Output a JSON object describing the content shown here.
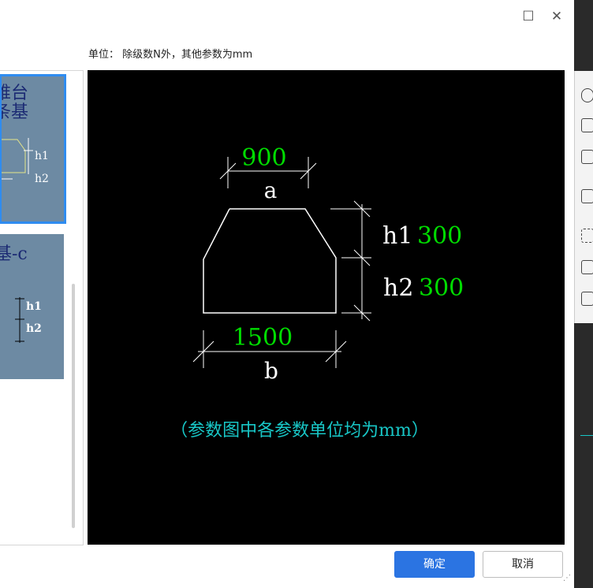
{
  "window": {
    "maximize_glyph": "☐",
    "close_glyph": "✕"
  },
  "unit_note": "单位： 除级数N外，其他参数为mm",
  "thumbnails": [
    {
      "title_line1": "锥台",
      "title_line2": "条基",
      "label1": "h1",
      "label2": "h2",
      "selected": true
    },
    {
      "title_line1": "基-c",
      "label1": "h1",
      "label2": "h2",
      "selected": false
    }
  ],
  "diagram": {
    "top_width_value": "900",
    "top_width_name": "a",
    "h1_name": "h1",
    "h1_value": "300",
    "h2_name": "h2",
    "h2_value": "300",
    "bottom_width_value": "1500",
    "bottom_width_name": "b",
    "note": "（参数图中各参数单位均为mm）"
  },
  "buttons": {
    "ok": "确定",
    "cancel": "取消"
  },
  "colors": {
    "green": "#00dd00",
    "cyan": "#18c7c7",
    "primary": "#2b74e2",
    "thumb_bg": "#6d8aa3"
  }
}
